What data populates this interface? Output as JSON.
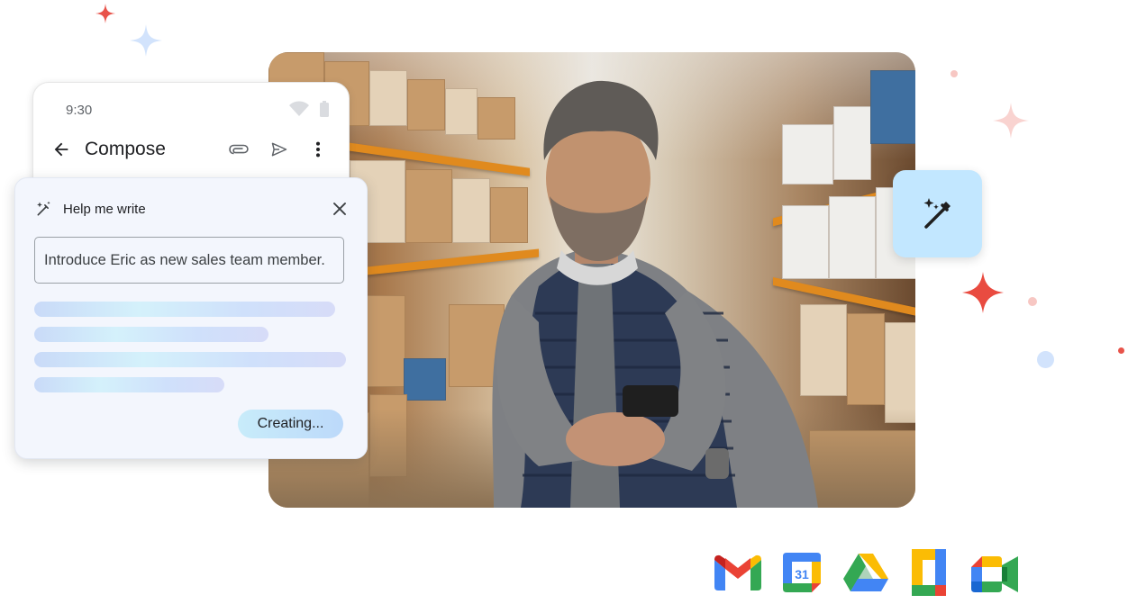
{
  "phone": {
    "time": "9:30",
    "compose_title": "Compose",
    "icons": [
      "wifi-icon",
      "battery-icon",
      "back-arrow-icon",
      "attachment-icon",
      "send-icon",
      "more-vert-icon"
    ]
  },
  "help_me_write": {
    "title": "Help me write",
    "prompt_value": "Introduce Eric as new sales team member.",
    "creating_label": "Creating...",
    "icons": [
      "magic-wand-icon",
      "close-icon"
    ]
  },
  "wand_tile": {
    "icon": "magic-wand-icon",
    "color": "#c2e7ff"
  },
  "apps": [
    {
      "name": "gmail-icon"
    },
    {
      "name": "calendar-icon",
      "label": "31"
    },
    {
      "name": "drive-icon"
    },
    {
      "name": "docs-icon"
    },
    {
      "name": "meet-icon"
    }
  ],
  "colors": {
    "red": "#ea4335",
    "blue": "#4285f4",
    "yellow": "#fbbc04",
    "green": "#34a853",
    "card_bg": "#f3f6fd"
  }
}
